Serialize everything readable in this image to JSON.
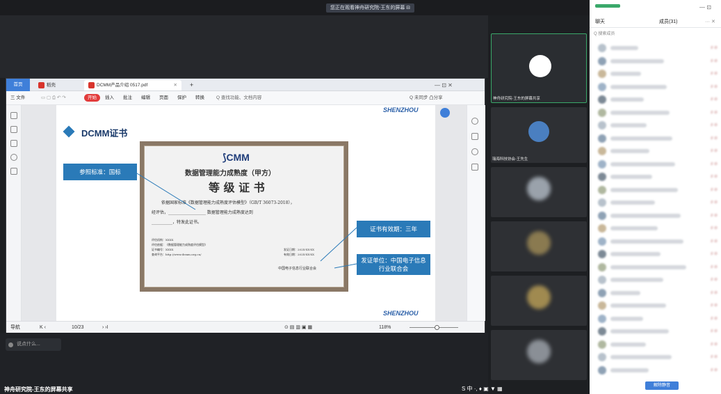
{
  "share_banner": "您正在观看神舟研究院-王东的屏幕",
  "share_banner_tail": "⊟",
  "window_controls": {
    "minimize": "—",
    "restore": "⊡"
  },
  "wps": {
    "tabs": {
      "home": "首页",
      "wps": "稻壳",
      "doc": "DCMM产品介绍 0517.pdf"
    },
    "menu": [
      "三 文件",
      "开始",
      "插入",
      "批注",
      "编辑",
      "页面",
      "保护",
      "转换",
      "Q 查找功能、文档内容"
    ],
    "menu_right": "Q 未同步  凸分享",
    "status": {
      "nav": "导航",
      "page": "10/23",
      "zoom": "118%"
    }
  },
  "doc": {
    "heading": "DCMM证书",
    "brand": "SHENZHOU",
    "cert_logo": "CMM",
    "cert_title1": "数据管理能力成熟度（甲方）",
    "cert_title2": "等 级 证 书",
    "cert_body1": "依据国家标准《数据管理能力成熟度评估模型》（GB/T 36073-2018），",
    "cert_body2": "经评估，__________________ 数据管理能力成熟度达到",
    "cert_body3": "__________，特发此证书。",
    "cert_small": [
      "评估机构：XXXX",
      "评估依据：《数据管理能力成熟度评估模型》",
      "证书编号：XXXX",
      "查询平台：http://www.dcmm.org.cn/"
    ],
    "cert_dates": [
      "发证日期：202X-XX-XX",
      "有效日期：202X-XX-XX"
    ],
    "cert_issuer": "中国电子信息行业联合会",
    "callout_standard": "参照标准：国标",
    "callout_validity": "证书有效期：三年",
    "callout_issuer": "发证单位：中国电子信息行业联合会"
  },
  "bottom_input": "说点什么...",
  "videos": [
    {
      "label": "神舟研究院-王东的屏幕共享"
    },
    {
      "label": "瑞海科技协会-王先生"
    }
  ],
  "chat": {
    "tab_chat": "聊天",
    "tab_members": "成员(31)",
    "search_placeholder": "Q 搜索成员",
    "bottom_button": "解除静音"
  },
  "bottom_caption": "神舟研究院-王东的屏幕共享",
  "taskbar": "S 中 ·, ♦ ▣ ▼ ▦"
}
